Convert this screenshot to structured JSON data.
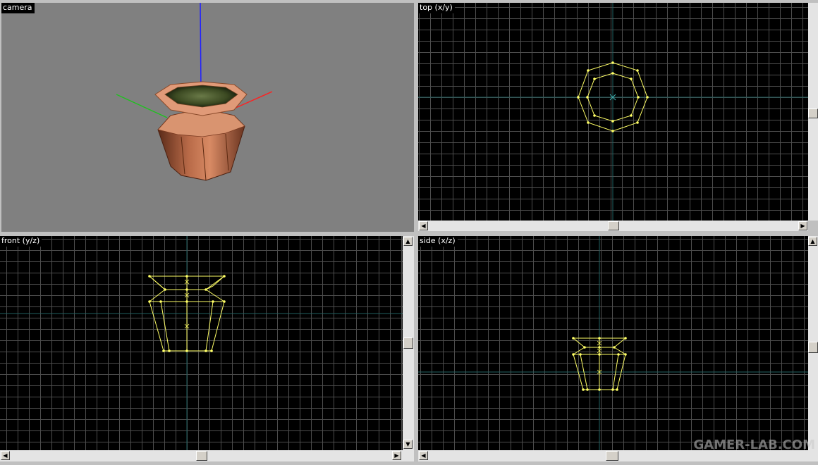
{
  "viewports": {
    "camera": {
      "label": "camera"
    },
    "top": {
      "label": "top (x/y)"
    },
    "front": {
      "label": "front (y/z)"
    },
    "side": {
      "label": "side (x/z)"
    }
  },
  "scrollbar_arrows": {
    "left": "◀",
    "right": "▶",
    "up": "▲",
    "down": "▼"
  },
  "watermark": "GAMER-LAB.COM",
  "colors": {
    "camera_bg": "#808080",
    "grid_line": "#4d4d4d",
    "axis_line": "#1f5f5f",
    "wireframe": "#ffff66",
    "axis_x": "#ff2020",
    "axis_y": "#20c020",
    "axis_z": "#2020ff"
  }
}
